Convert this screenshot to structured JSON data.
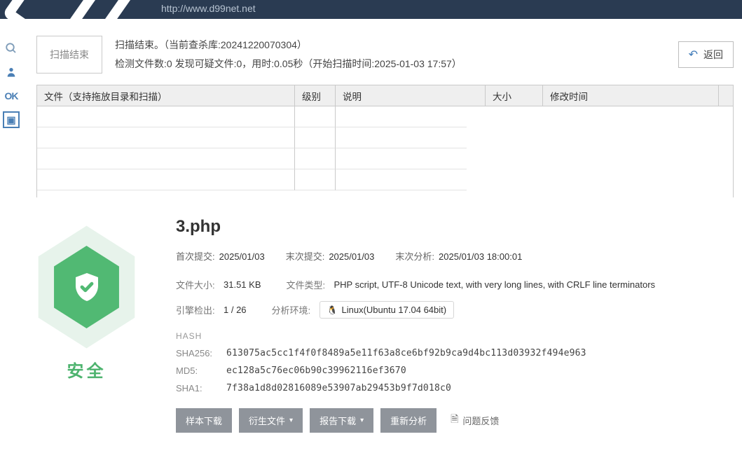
{
  "banner": {
    "url": "http://www.d99net.net"
  },
  "scanner": {
    "status_label": "扫描结束",
    "line1": "扫描结束。（当前查杀库:20241220070304）",
    "line2": "检测文件数:0 发现可疑文件:0，用时:0.05秒（开始扫描时间:2025-01-03 17:57）",
    "back": "返回",
    "headers": {
      "file": "文件（支持拖放目录和扫描）",
      "level": "级别",
      "desc": "说明",
      "size": "大小",
      "time": "修改时间"
    }
  },
  "report": {
    "safe_label": "安全",
    "filename": "3.php",
    "first_submit_label": "首次提交:",
    "first_submit": "2025/01/03",
    "last_submit_label": "末次提交:",
    "last_submit": "2025/01/03",
    "last_analyze_label": "末次分析:",
    "last_analyze": "2025/01/03 18:00:01",
    "filesize_label": "文件大小:",
    "filesize": "31.51 KB",
    "filetype_label": "文件类型:",
    "filetype": "PHP script, UTF-8 Unicode text, with very long lines, with CRLF line terminators",
    "detect_label": "引擎检出:",
    "detect_hit": "1",
    "detect_total": " / 26",
    "env_label": "分析环境:",
    "env_value": "Linux(Ubuntu 17.04 64bit)",
    "hash_title": "HASH",
    "sha256_label": "SHA256:",
    "sha256": "613075ac5cc1f4f0f8489a5e11f63a8ce6bf92b9ca9d4bc113d03932f494e963",
    "md5_label": "MD5:",
    "md5": "ec128a5c76ec06b90c39962116ef3670",
    "sha1_label": "SHA1:",
    "sha1": "7f38a1d8d02816089e53907ab29453b9f7d018c0",
    "buttons": {
      "sample": "样本下载",
      "derived": "衍生文件",
      "report_dl": "报告下载",
      "reanalyze": "重新分析",
      "feedback": "问题反馈"
    }
  }
}
